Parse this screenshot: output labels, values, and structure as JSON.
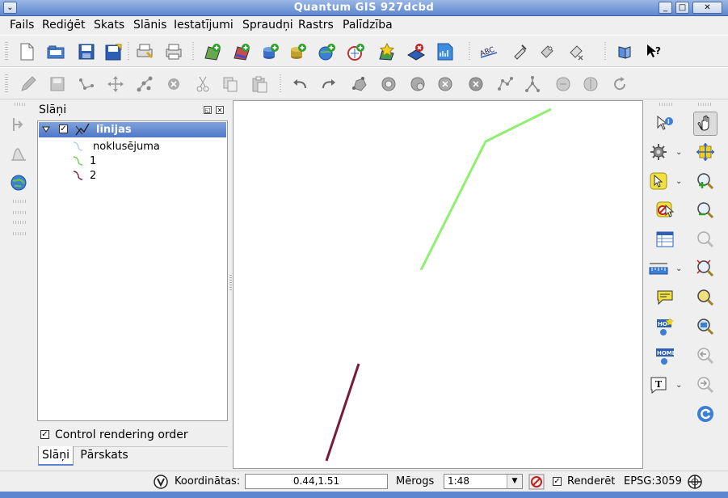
{
  "window": {
    "title": "Quantum GIS 927dcbd",
    "menu_icon": "chevron-down-icon",
    "min_label": "_",
    "max_label": "□",
    "close_label": "✕"
  },
  "menu": {
    "items": [
      "Fails",
      "Rediģēt",
      "Skats",
      "Slānis",
      "Iestatījumi",
      "Spraudņi",
      "Rastrs",
      "Palīdzība"
    ]
  },
  "toolbar1": {
    "icons": [
      "new-project-icon",
      "open-project-icon",
      "save-project-icon",
      "save-as-icon",
      "print-composer-icon",
      "print-icon",
      "add-vector-layer-icon",
      "add-raster-layer-icon",
      "add-postgis-layer-icon",
      "add-spatialite-layer-icon",
      "add-wms-layer-icon",
      "add-wfs-layer-icon",
      "new-vector-layer-icon",
      "remove-layer-icon",
      "toggle-fullscreen-icon",
      "labeling-icon",
      "pin-labels-icon",
      "move-label-icon",
      "help-contents-icon",
      "whats-this-icon"
    ]
  },
  "toolbar2": {
    "icons": [
      "toggle-edit-icon",
      "save-edits-icon",
      "add-feature-icon",
      "move-feature-icon",
      "node-tool-icon",
      "delete-selected-icon",
      "cut-features-icon",
      "copy-features-icon",
      "paste-features-icon",
      "undo-icon",
      "redo-icon",
      "simplify-feature-icon",
      "add-ring-icon",
      "add-part-icon",
      "delete-ring-icon",
      "delete-part-icon",
      "reshape-features-icon",
      "split-features-icon",
      "merge-features-icon",
      "merge-attributes-icon",
      "rotate-point-symbols-icon"
    ]
  },
  "layers_panel": {
    "title": "Slāņi",
    "layer_name": "līnijas",
    "legend_items": [
      "noklusējuma",
      "1",
      "2"
    ],
    "control_rendering_label": "Control rendering order",
    "control_rendering_checked": true,
    "tabs": [
      "Slāņi",
      "Pārskats"
    ]
  },
  "map": {
    "lines": [
      {
        "color": "#90ee70",
        "points": [
          [
            521,
            334
          ],
          [
            601,
            175
          ],
          [
            682,
            135
          ]
        ]
      },
      {
        "color": "#7a1a3a",
        "points": [
          [
            444,
            450
          ],
          [
            404,
            570
          ]
        ]
      }
    ]
  },
  "statusbar": {
    "coord_label": "Koordinātas:",
    "coord_value": "0.44,1.51",
    "scale_label": "Mērogs",
    "scale_value": "1:48",
    "render_label": "Renderēt",
    "render_checked": true,
    "crs": "EPSG:3059"
  },
  "colors": {
    "titlebar": "#5c86cf",
    "selection": "#4e78c6",
    "green_line": "#90ee70",
    "maroon_line": "#7a1a3a"
  }
}
